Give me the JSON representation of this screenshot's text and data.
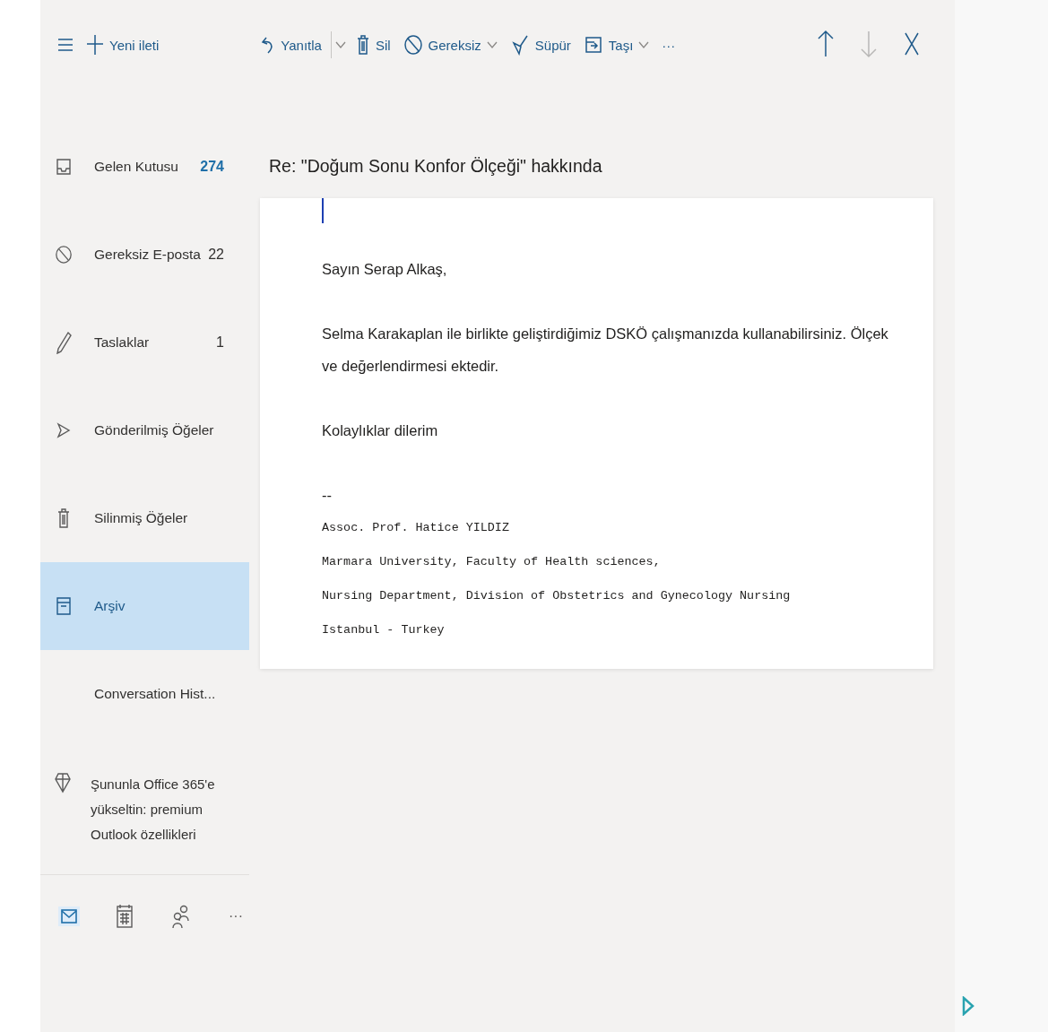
{
  "toolbar": {
    "new_message": "Yeni ileti",
    "actions": [
      {
        "label": "Yanıtla",
        "dropdown": true,
        "split": true
      },
      {
        "label": "Sil",
        "dropdown": false,
        "split": false
      },
      {
        "label": "Gereksiz",
        "dropdown": true,
        "split": false
      },
      {
        "label": "Süpür",
        "dropdown": false,
        "split": false
      },
      {
        "label": "Taşı",
        "dropdown": true,
        "split": false
      }
    ],
    "more": "···",
    "nav": [
      {
        "disabled": false
      },
      {
        "disabled": true
      },
      {
        "disabled": false
      }
    ]
  },
  "sidebar": {
    "folders": [
      {
        "name": "Gelen Kutusu",
        "count": "274",
        "unread": true,
        "selected": false
      },
      {
        "name": "Gereksiz E-posta",
        "count": "22",
        "unread": false,
        "selected": false
      },
      {
        "name": "Taslaklar",
        "count": "1",
        "unread": false,
        "selected": false
      },
      {
        "name": "Gönderilmiş Öğeler",
        "selected": false
      },
      {
        "name": "Silinmiş Öğeler",
        "selected": false
      },
      {
        "name": "Arşiv",
        "selected": true
      },
      {
        "name": "Conversation Hist...",
        "selected": false
      }
    ],
    "promo": {
      "text": "Şununla Office 365'e yükseltin: premium Outlook özellikleri"
    },
    "apps": [
      {
        "selected": true
      },
      {
        "selected": false
      },
      {
        "selected": false
      },
      {
        "label": "···",
        "selected": false
      }
    ]
  },
  "message": {
    "subject": "Re: \"Doğum Sonu Konfor Ölçeği\" hakkında",
    "body": [
      {
        "kind": "text",
        "text": "Sayın Serap Alkaş,"
      },
      {
        "kind": "text",
        "text": "Selma Karakaplan ile birlikte geliştirdiğimiz DSKÖ çalışmanızda kullanabilirsiniz. Ölçek ve değerlendirmesi ektedir."
      },
      {
        "kind": "text",
        "text": "Kolaylıklar dilerim"
      },
      {
        "kind": "dash",
        "text": "--"
      },
      {
        "kind": "mono",
        "text": "Assoc. Prof. Hatice YILDIZ"
      },
      {
        "kind": "mono",
        "text": "Marmara University, Faculty of Health sciences,"
      },
      {
        "kind": "mono",
        "text": "Nursing Department, Division of Obstetrics and Gynecology Nursing"
      },
      {
        "kind": "mono",
        "text": "Istanbul - Turkey"
      }
    ]
  }
}
